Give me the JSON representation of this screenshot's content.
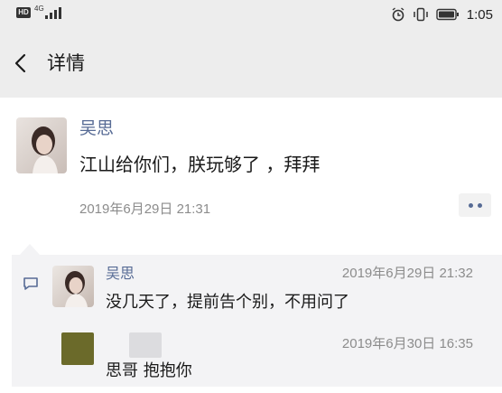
{
  "status_bar": {
    "hd_badge": "HD",
    "network": "4G",
    "time": "1:05",
    "icons": [
      "signal-icon",
      "alarm-icon",
      "vibrate-icon",
      "battery-icon"
    ]
  },
  "nav": {
    "back_icon": "chevron-left-icon",
    "title": "详情"
  },
  "post": {
    "author": "吴思",
    "text": "江山给你们，朕玩够了 ，拜拜",
    "time": "2019年6月29日 21:31",
    "more_icon": "more-dots-icon"
  },
  "comments": {
    "icon": "comment-icon",
    "items": [
      {
        "author": "吴思",
        "time": "2019年6月29日 21:32",
        "text": "没几天了，提前告个别，不用问了"
      },
      {
        "author": "",
        "time": "2019年6月30日 16:35",
        "text": "思哥 抱抱你"
      }
    ]
  },
  "colors": {
    "accent": "#576b95",
    "background_gray": "#ededed",
    "comment_bg": "#f3f3f5",
    "text_secondary": "#8c8c8c"
  }
}
